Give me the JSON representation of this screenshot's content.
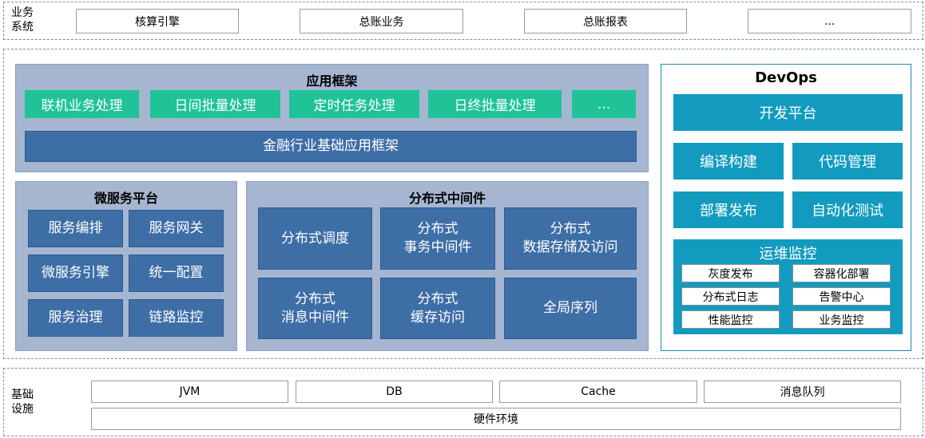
{
  "business": {
    "label_line1": "业务",
    "label_line2": "系统",
    "items": [
      "核算引擎",
      "总账业务",
      "总账报表",
      "..."
    ]
  },
  "app_framework": {
    "title": "应用框架",
    "modes": [
      "联机业务处理",
      "日间批量处理",
      "定时任务处理",
      "日终批量处理",
      "..."
    ],
    "base": "金融行业基础应用框架"
  },
  "microservice": {
    "title": "微服务平台",
    "items": [
      "服务编排",
      "服务网关",
      "微服务引擎",
      "统一配置",
      "服务治理",
      "链路监控"
    ]
  },
  "middleware": {
    "title": "分布式中间件",
    "items": [
      {
        "line1": "分布式调度",
        "line2": ""
      },
      {
        "line1": "分布式",
        "line2": "事务中间件"
      },
      {
        "line1": "分布式",
        "line2": "数据存储及访问"
      },
      {
        "line1": "分布式",
        "line2": "消息中间件"
      },
      {
        "line1": "分布式",
        "line2": "缓存访问"
      },
      {
        "line1": "全局序列",
        "line2": ""
      }
    ]
  },
  "devops": {
    "title": "DevOps",
    "dev_platform": "开发平台",
    "items": [
      "编译构建",
      "代码管理",
      "部署发布",
      "自动化测试"
    ],
    "ops": {
      "title": "运维监控",
      "items": [
        "灰度发布",
        "容器化部署",
        "分布式日志",
        "告警中心",
        "性能监控",
        "业务监控"
      ]
    }
  },
  "infra": {
    "label_line1": "基础",
    "label_line2": "设施",
    "items": [
      "JVM",
      "DB",
      "Cache",
      "消息队列"
    ],
    "hardware": "硬件环境"
  }
}
